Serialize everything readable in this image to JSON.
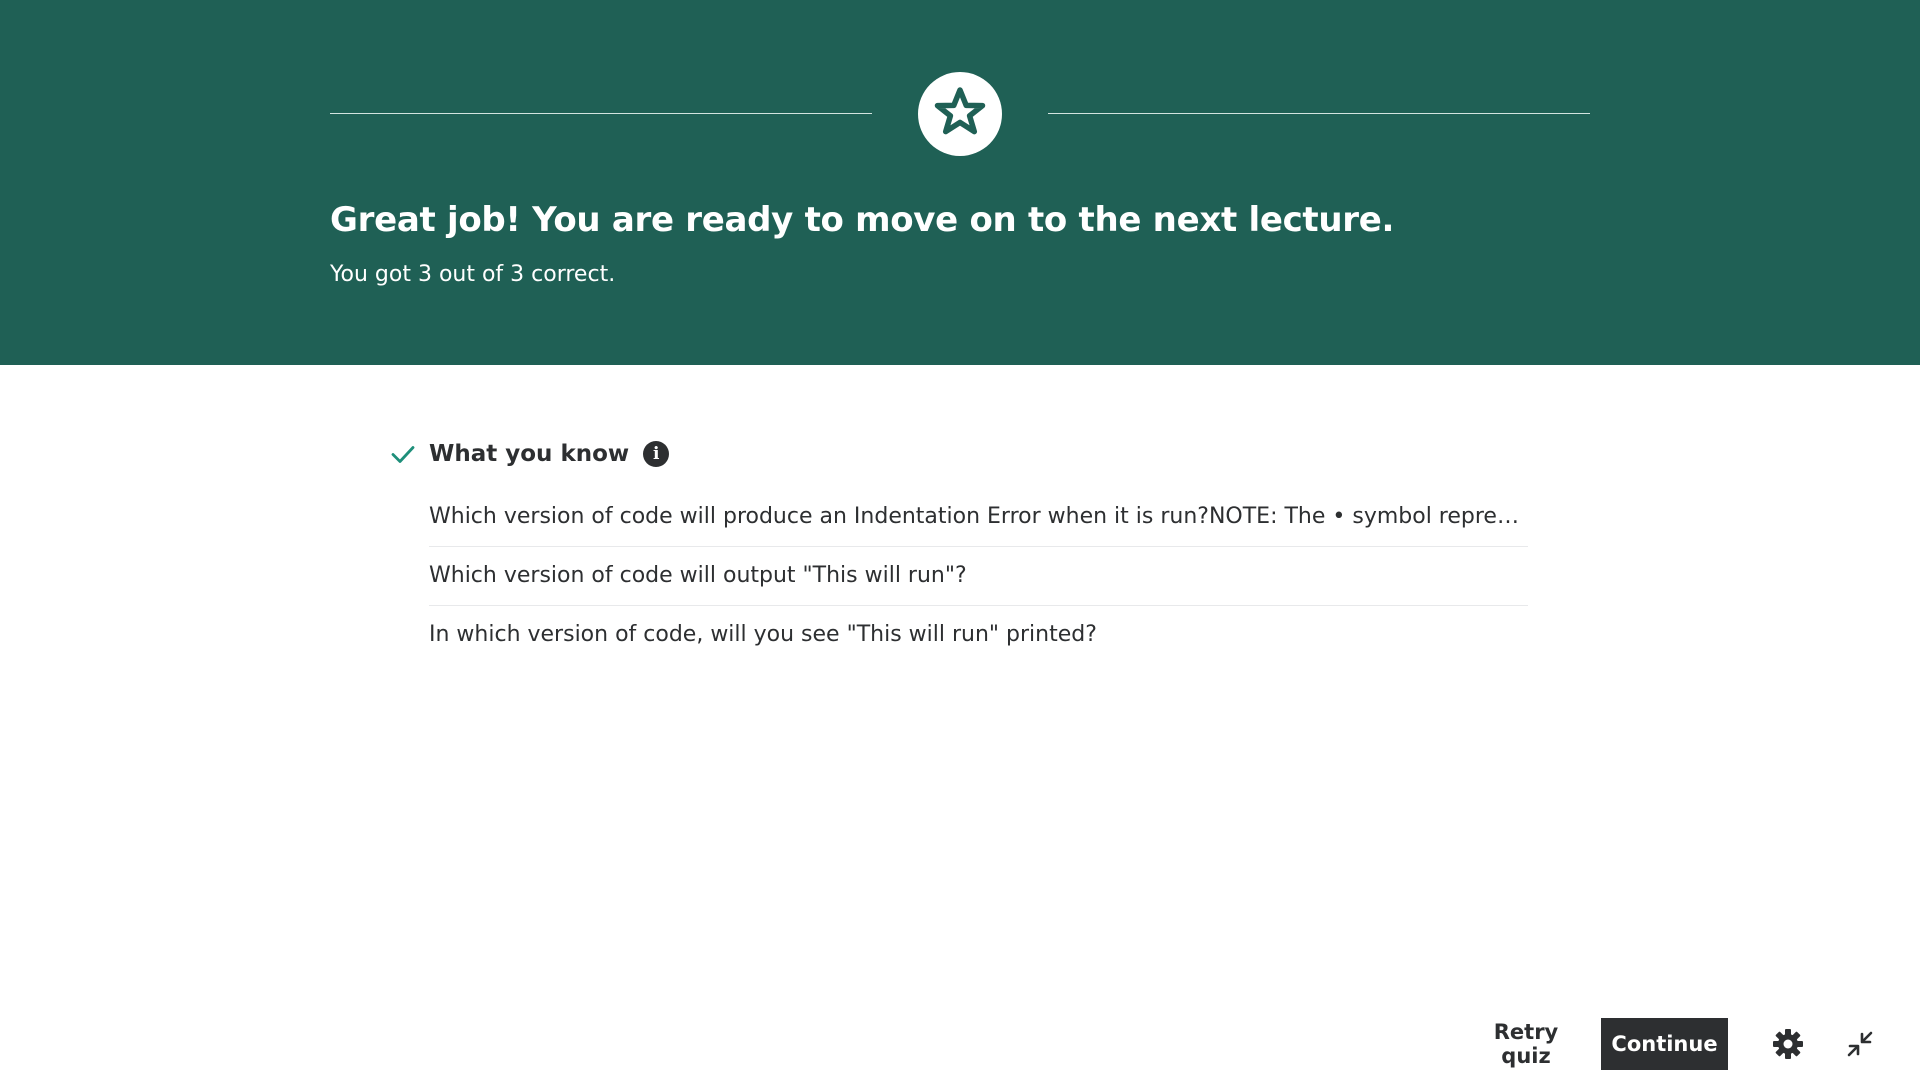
{
  "banner": {
    "title": "Great job! You are ready to move on to the next lecture.",
    "subtitle": "You got 3 out of 3 correct.",
    "background_color": "#1f6055",
    "badge_icon": "star-icon"
  },
  "knowledge": {
    "title": "What you know",
    "status_icon": "checkmark-icon",
    "check_color": "#1e8f7a",
    "info_icon_label": "i",
    "questions": [
      "Which version of code will produce an Indentation Error when it is run?NOTE: The • symbol represent...",
      "Which version of code will output \"This will run\"?",
      "In which version of code, will you see \"This will run\" printed?"
    ]
  },
  "footer": {
    "retry_label": "Retry quiz",
    "continue_label": "Continue",
    "continue_color": "#2d2f31",
    "settings_icon": "gear-icon",
    "collapse_icon": "collapse-icon"
  }
}
